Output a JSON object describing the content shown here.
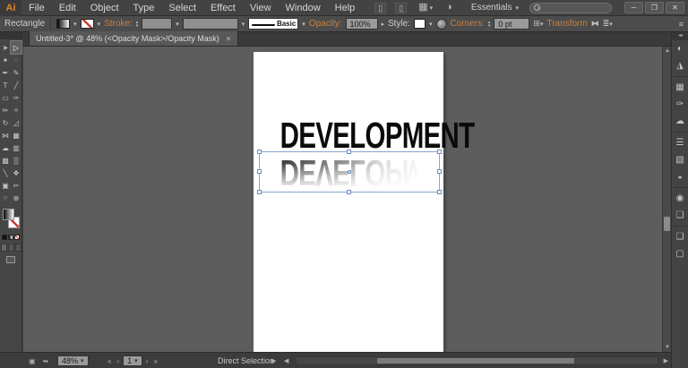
{
  "app_bar": {
    "logo": "Ai",
    "menus": [
      "File",
      "Edit",
      "Object",
      "Type",
      "Select",
      "Effect",
      "View",
      "Window",
      "Help"
    ],
    "workspace_switcher": "Essentials",
    "search_placeholder": ""
  },
  "control_bar": {
    "context": "Rectangle",
    "stroke_label": "Stroke:",
    "brush_name": "Basic",
    "opacity_label": "Opacity:",
    "opacity_value": "100%",
    "style_label": "Style:",
    "corners_label": "Corners:",
    "corners_value": "0 pt",
    "transform_label": "Transform"
  },
  "document_tab": {
    "title": "Untitled-3* @ 48% (<Opacity Mask>/Opacity Mask)"
  },
  "artboard": {
    "headline_text": "DEVELOPMENT",
    "reflection_text": "DEVELOPMENT"
  },
  "status_bar": {
    "zoom": "48%",
    "artboard_number": "1",
    "active_tool": "Direct Selection"
  },
  "tools": [
    {
      "name": "selection-tool",
      "glyph": "➤"
    },
    {
      "name": "direct-selection-tool",
      "glyph": "▷",
      "active": true
    },
    {
      "name": "magic-wand-tool",
      "glyph": "✦"
    },
    {
      "name": "lasso-tool",
      "glyph": "◌"
    },
    {
      "name": "pen-tool",
      "glyph": "✒"
    },
    {
      "name": "curvature-tool",
      "glyph": "✎"
    },
    {
      "name": "type-tool",
      "glyph": "T"
    },
    {
      "name": "line-segment-tool",
      "glyph": "╱"
    },
    {
      "name": "rectangle-tool",
      "glyph": "▭"
    },
    {
      "name": "paintbrush-tool",
      "glyph": "✑"
    },
    {
      "name": "pencil-tool",
      "glyph": "✏"
    },
    {
      "name": "shaper-tool",
      "glyph": "✧"
    },
    {
      "name": "rotate-tool",
      "glyph": "↻"
    },
    {
      "name": "scale-tool",
      "glyph": "◿"
    },
    {
      "name": "width-tool",
      "glyph": "⋈"
    },
    {
      "name": "free-transform-tool",
      "glyph": "▦"
    },
    {
      "name": "symbol-sprayer-tool",
      "glyph": "☁"
    },
    {
      "name": "column-graph-tool",
      "glyph": "▥"
    },
    {
      "name": "mesh-tool",
      "glyph": "▩"
    },
    {
      "name": "gradient-tool",
      "glyph": "▒"
    },
    {
      "name": "eyedropper-tool",
      "glyph": "╲"
    },
    {
      "name": "blend-tool",
      "glyph": "❖"
    },
    {
      "name": "artboard-tool",
      "glyph": "▣"
    },
    {
      "name": "slice-tool",
      "glyph": "✂"
    },
    {
      "name": "hand-tool",
      "glyph": "☞"
    },
    {
      "name": "zoom-tool",
      "glyph": "⊕"
    }
  ],
  "panels": {
    "items": [
      {
        "name": "color-panel",
        "glyph": "◐"
      },
      {
        "name": "color-guide-panel",
        "glyph": "◮"
      },
      {
        "name": "swatches-panel",
        "glyph": "▦"
      },
      {
        "name": "brushes-panel",
        "glyph": "✑"
      },
      {
        "name": "symbols-panel",
        "glyph": "☁"
      },
      {
        "name": "stroke-panel",
        "glyph": "☰"
      },
      {
        "name": "gradient-panel",
        "glyph": "▧"
      },
      {
        "name": "transparency-panel",
        "glyph": "◒"
      },
      {
        "name": "appearance-panel",
        "glyph": "◉"
      },
      {
        "name": "graphic-styles-panel",
        "glyph": "❏"
      },
      {
        "name": "layers-panel",
        "glyph": "❑"
      },
      {
        "name": "artboards-panel",
        "glyph": "▢"
      }
    ],
    "separators_after": [
      1,
      4,
      7,
      9
    ]
  },
  "icons": {
    "dropdown_down": "▾",
    "dropdown_right": "▸",
    "stepper_up": "▴",
    "stepper_down": "▾",
    "tab_close": "✕",
    "minimize": "─",
    "restore": "❐",
    "close": "✕",
    "scroll_up": "▲",
    "scroll_down": "▼",
    "scroll_left": "◀",
    "scroll_right": "▶",
    "nav_first": "«",
    "nav_prev": "‹",
    "nav_next": "›",
    "nav_last": "»",
    "dock_collapse": "◂◂",
    "app_icon_1": "▯",
    "app_icon_2": "▯",
    "arrange_documents": "▦",
    "cs_live": "◗",
    "align_options": "⊞",
    "isolate": "⧓",
    "more_options": "≣",
    "panel_menu": "≡",
    "status_icon_1": "▣",
    "status_icon_2": "➥"
  }
}
